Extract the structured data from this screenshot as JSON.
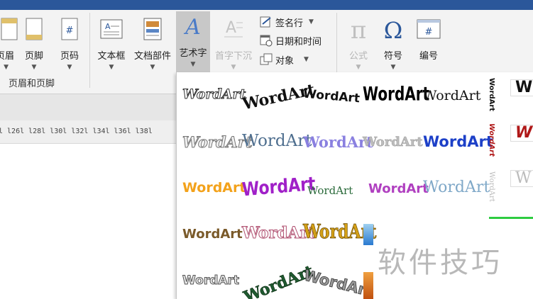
{
  "ribbon": {
    "header_footer": {
      "header_label": "页眉",
      "footer_label": "页脚",
      "page_number_label": "页码",
      "group_label": "页眉和页脚"
    },
    "text": {
      "textbox_label": "文本框",
      "quick_parts_label": "文档部件",
      "wordart_label": "艺术字",
      "dropcap_label": "首字下沉",
      "signature_label": "签名行",
      "datetime_label": "日期和时间",
      "object_label": "对象"
    },
    "symbols": {
      "equation_label": "公式",
      "symbol_label": "符号",
      "number_label": "编号"
    }
  },
  "ruler": {
    "ticks": "l  l26l  l28l  l30l  l32l  l34l  l36l  l38l"
  },
  "gallery": {
    "items": [
      "WordArt",
      "WordArt",
      "WordArt",
      "WordArt",
      "WordArt",
      "WordArt",
      "WordArt",
      "WordArt",
      "WordArt",
      "WordArt",
      "WordArt",
      "WordArt",
      "WordArt",
      "WordArt",
      "WordArt",
      "WordArt",
      "WordArt",
      "WordArt",
      "WordArt",
      "WordArt",
      "WordArt"
    ],
    "partial_right": [
      "W",
      "W",
      "W"
    ],
    "vertical": [
      "WordArt",
      "WordArt",
      "WordArt"
    ]
  },
  "watermark": "软件技巧",
  "colors": {
    "accent": "#2b579a",
    "active_button": "#c8c8c8"
  }
}
